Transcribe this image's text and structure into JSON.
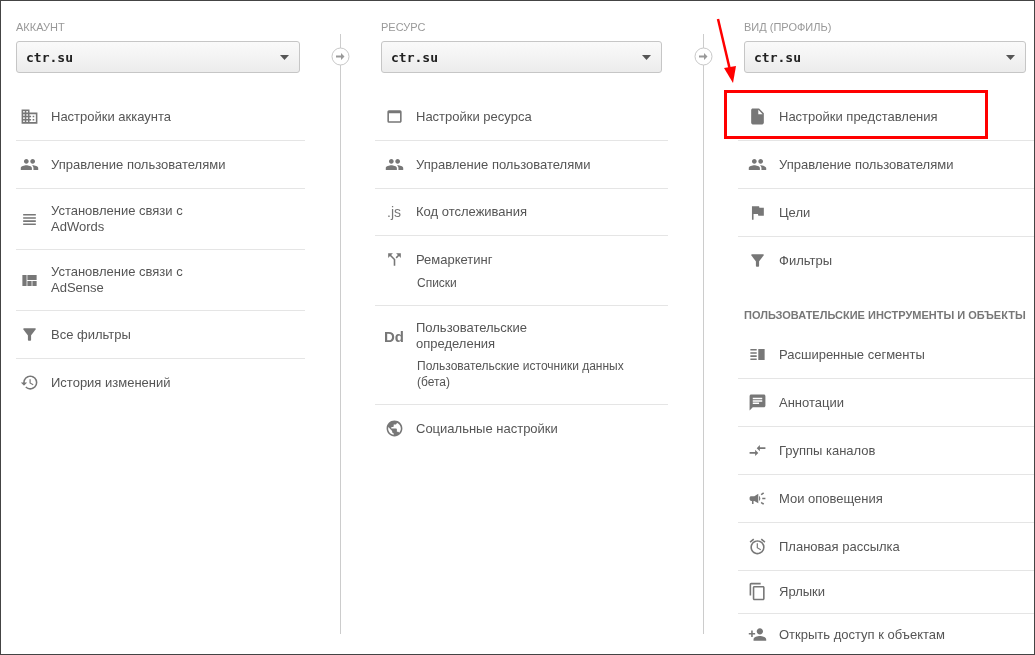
{
  "columns": [
    {
      "label": "АККАУНТ",
      "select": {
        "value": "ctr.su"
      },
      "items": [
        {
          "kind": "link",
          "label": "Настройки аккаунта",
          "highlighted": false
        },
        {
          "kind": "link",
          "label": "Управление пользователями",
          "highlighted": false
        },
        {
          "kind": "link",
          "label": "Установление связи с AdWords",
          "highlighted": false
        },
        {
          "kind": "link",
          "label": "Установление связи с AdSense",
          "highlighted": false
        },
        {
          "kind": "link",
          "label": "Все фильтры",
          "highlighted": false
        },
        {
          "kind": "link",
          "label": "История изменений",
          "highlighted": false,
          "divider": false
        }
      ]
    },
    {
      "label": "РЕСУРС",
      "select": {
        "value": "ctr.su"
      },
      "items": [
        {
          "kind": "link",
          "label": "Настройки ресурса",
          "highlighted": false
        },
        {
          "kind": "link",
          "label": "Управление пользователями",
          "highlighted": false
        },
        {
          "kind": "link",
          "label": "Код отслеживания",
          "highlighted": false,
          "icon_text": ".js"
        },
        {
          "kind": "link",
          "label": "Ремаркетинг",
          "highlighted": false,
          "children": [
            {
              "label": "Списки"
            }
          ]
        },
        {
          "kind": "link",
          "label": "Пользовательские определения",
          "highlighted": false,
          "icon_text": "Dd",
          "children": [
            {
              "label": "Пользовательские источники данных (бета)"
            }
          ]
        },
        {
          "kind": "link",
          "label": "Социальные настройки",
          "highlighted": false,
          "divider": false
        }
      ]
    },
    {
      "label": "ВИД (ПРОФИЛЬ)",
      "select": {
        "value": "ctr.su"
      },
      "items": [
        {
          "kind": "link",
          "label": "Настройки представления",
          "highlighted": true
        },
        {
          "kind": "link",
          "label": "Управление пользователями",
          "highlighted": false
        },
        {
          "kind": "link",
          "label": "Цели",
          "highlighted": false
        },
        {
          "kind": "link",
          "label": "Фильтры",
          "highlighted": false,
          "divider": false
        },
        {
          "kind": "heading",
          "label": "ПОЛЬЗОВАТЕЛЬСКИЕ ИНСТРУМЕНТЫ И ОБЪЕКТЫ"
        },
        {
          "kind": "link",
          "label": "Расширенные сегменты",
          "highlighted": false
        },
        {
          "kind": "link",
          "label": "Аннотации",
          "highlighted": false
        },
        {
          "kind": "link",
          "label": "Группы каналов",
          "highlighted": false
        },
        {
          "kind": "link",
          "label": "Мои оповещения",
          "highlighted": false
        },
        {
          "kind": "link",
          "label": "Плановая рассылка",
          "highlighted": false
        },
        {
          "kind": "link",
          "label": "Ярлыки",
          "highlighted": false,
          "compact": true
        },
        {
          "kind": "link",
          "label": "Открыть доступ к объектам",
          "highlighted": false,
          "compact": true,
          "divider": false
        }
      ]
    }
  ]
}
